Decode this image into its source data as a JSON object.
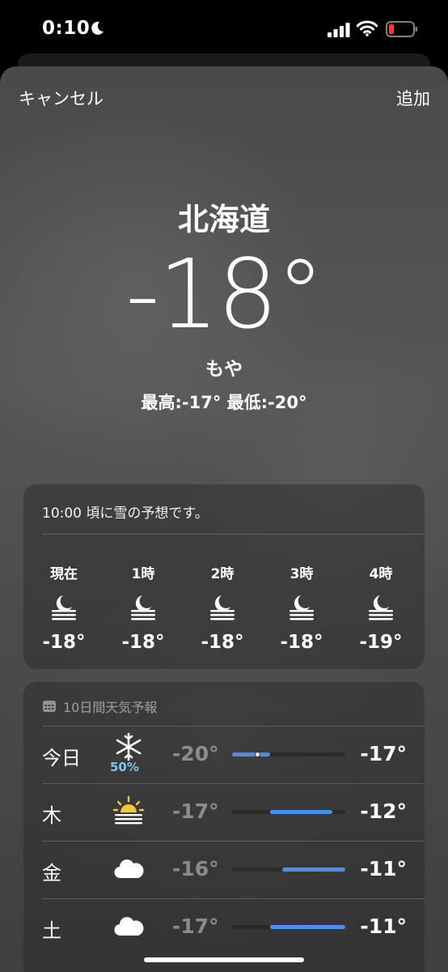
{
  "status_bar": {
    "time": "0:10"
  },
  "nav": {
    "cancel_label": "キャンセル",
    "add_label": "追加"
  },
  "current": {
    "location": "北海道",
    "temperature": "-18°",
    "condition": "もや",
    "hilo": "最高:-17°  最低:-20°"
  },
  "hourly": {
    "summary": "10:00 頃に雪の予想です。",
    "items": [
      {
        "label": "現在",
        "icon": "moon-fog-icon",
        "temp": "-18°"
      },
      {
        "label": "1時",
        "icon": "moon-fog-icon",
        "temp": "-18°"
      },
      {
        "label": "2時",
        "icon": "moon-fog-icon",
        "temp": "-18°"
      },
      {
        "label": "3時",
        "icon": "moon-fog-icon",
        "temp": "-18°"
      },
      {
        "label": "4時",
        "icon": "moon-fog-icon",
        "temp": "-19°"
      }
    ]
  },
  "daily": {
    "header": "10日間天気予報",
    "scale_min": -20,
    "scale_max": -11,
    "days": [
      {
        "name": "今日",
        "icon": "snowflake-icon",
        "precip": "50%",
        "low": "-20°",
        "high": "-17°",
        "low_val": -20,
        "high_val": -17,
        "current_val": -18
      },
      {
        "name": "木",
        "icon": "sun-haze-icon",
        "precip": "",
        "low": "-17°",
        "high": "-12°",
        "low_val": -17,
        "high_val": -12
      },
      {
        "name": "金",
        "icon": "cloud-icon",
        "precip": "",
        "low": "-16°",
        "high": "-11°",
        "low_val": -16,
        "high_val": -11
      },
      {
        "name": "土",
        "icon": "cloud-icon",
        "precip": "",
        "low": "-17°",
        "high": "-11°",
        "low_val": -17,
        "high_val": -11
      }
    ]
  },
  "colors": {
    "range_fill": "#4a90e8",
    "precip": "#7fc4f2",
    "battery_low": "#ff3b30",
    "sun": "#f5c542"
  }
}
